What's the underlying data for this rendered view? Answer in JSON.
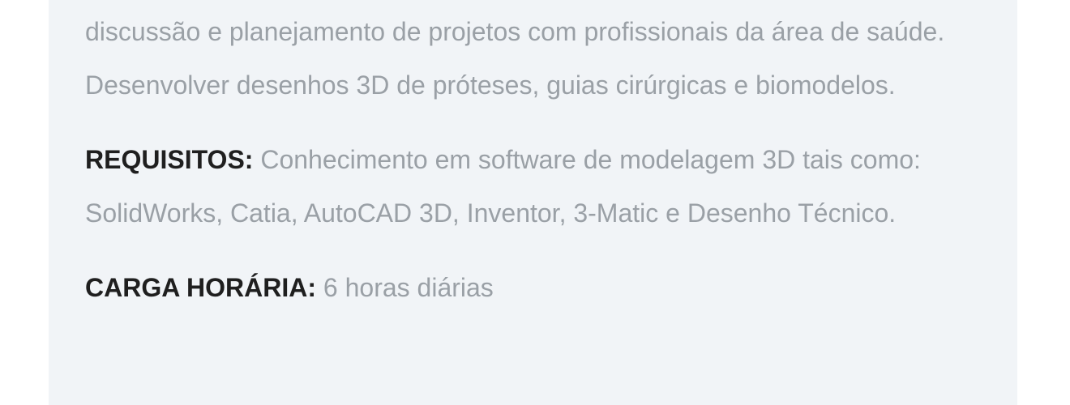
{
  "description": {
    "text": "discussão e planejamento de projetos com profissionais da área de saúde. Desenvolver desenhos 3D de próteses, guias cirúrgicas e biomodelos."
  },
  "requirements": {
    "label": "REQUISITOS:",
    "text": "Conhecimento em software de modelagem 3D tais como: SolidWorks, Catia, AutoCAD 3D, Inventor, 3-Matic e Desenho Técnico."
  },
  "workload": {
    "label": "CARGA HORÁRIA:",
    "text": "6 horas diárias"
  }
}
